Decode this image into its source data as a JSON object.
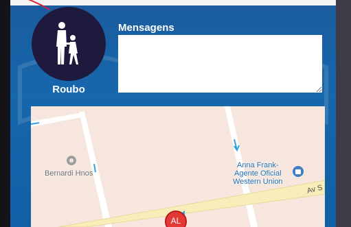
{
  "category": {
    "label": "Roubo",
    "icon": "adult-child-icon",
    "circle_color": "#1d1a3d"
  },
  "messages": {
    "label": "Mensagens",
    "value": ""
  },
  "map": {
    "pois": [
      {
        "name": "bernardi-hnos",
        "label": "Bernardi Hnos",
        "icon": "location-pin-icon"
      },
      {
        "name": "anna-frank",
        "label": "Anna Frank-\nAgente Oficial\nWestern Union",
        "icon": "shopping-bag-icon"
      }
    ],
    "street_label": "Av S",
    "marker_label": "AL",
    "marker_color": "#e53935"
  },
  "colors": {
    "header_blue": "#1767ad",
    "map_background": "#f6e6dd",
    "road_main": "#f8edb8"
  }
}
